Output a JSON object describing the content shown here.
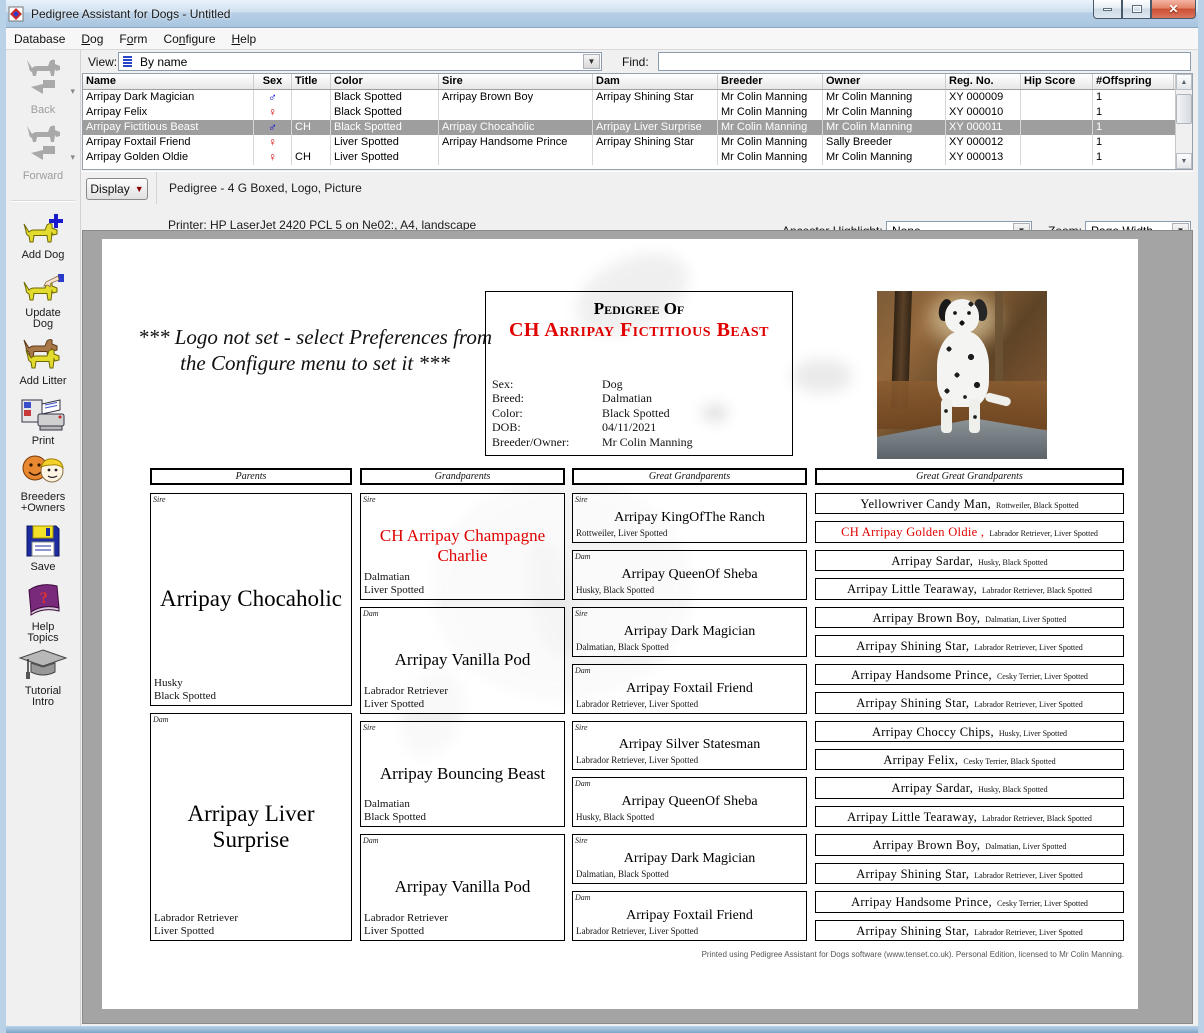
{
  "window": {
    "title": "Pedigree Assistant for Dogs - Untitled"
  },
  "menu": [
    {
      "pre": "Database",
      "u": "",
      "post": ""
    },
    {
      "pre": "",
      "u": "D",
      "post": "og"
    },
    {
      "pre": "F",
      "u": "o",
      "post": "rm"
    },
    {
      "pre": "Co",
      "u": "n",
      "post": "figure"
    },
    {
      "pre": "",
      "u": "H",
      "post": "elp"
    }
  ],
  "finder": {
    "view_label": "View:",
    "view_value": "By name",
    "find_label": "Find:",
    "find_value": ""
  },
  "grid": {
    "columns": [
      "Name",
      "Sex",
      "Title",
      "Color",
      "Sire",
      "Dam",
      "Breeder",
      "Owner",
      "Reg. No.",
      "Hip Score",
      "#Offspring"
    ],
    "rows": [
      {
        "name": "Arripay Dark Magician",
        "sex_glyph": "♂",
        "sex_class": "male",
        "title": "",
        "color": "Black Spotted",
        "sire": "Arripay Brown Boy",
        "dam": "Arripay Shining Star",
        "breeder": "Mr Colin Manning",
        "owner": "Mr Colin Manning",
        "reg_no": "XY 000009",
        "hip_score": "",
        "offspring": "1",
        "selected": false
      },
      {
        "name": "Arripay Felix",
        "sex_glyph": "♀",
        "sex_class": "female",
        "title": "",
        "color": "Black Spotted",
        "sire": "",
        "dam": "",
        "breeder": "Mr Colin Manning",
        "owner": "Mr Colin Manning",
        "reg_no": "XY 000010",
        "hip_score": "",
        "offspring": "1",
        "selected": false
      },
      {
        "name": "Arripay Fictitious Beast",
        "sex_glyph": "♂",
        "sex_class": "male",
        "title": "CH",
        "color": "Black Spotted",
        "sire": "Arripay Chocaholic",
        "dam": "Arripay Liver Surprise",
        "breeder": "Mr Colin Manning",
        "owner": "Mr Colin Manning",
        "reg_no": "XY 000011",
        "hip_score": "",
        "offspring": "1",
        "selected": true
      },
      {
        "name": "Arripay Foxtail Friend",
        "sex_glyph": "♀",
        "sex_class": "female",
        "title": "",
        "color": "Liver Spotted",
        "sire": "Arripay Handsome Prince",
        "dam": "Arripay Shining Star",
        "breeder": "Mr Colin Manning",
        "owner": "Sally Breeder",
        "reg_no": "XY 000012",
        "hip_score": "",
        "offspring": "1",
        "selected": false
      },
      {
        "name": "Arripay Golden Oldie",
        "sex_glyph": "♀",
        "sex_class": "female",
        "title": "CH",
        "color": "Liver Spotted",
        "sire": "",
        "dam": "",
        "breeder": "Mr Colin Manning",
        "owner": "Mr Colin Manning",
        "reg_no": "XY 000013",
        "hip_score": "",
        "offspring": "1",
        "selected": false
      }
    ]
  },
  "sidebar": [
    {
      "label": "Back",
      "disabled": true
    },
    {
      "label": "Forward",
      "disabled": true
    },
    {
      "label": "Add Dog",
      "disabled": false
    },
    {
      "label": "Update\nDog",
      "disabled": false
    },
    {
      "label": "Add Litter",
      "disabled": false
    },
    {
      "label": "Print",
      "disabled": false
    },
    {
      "label": "Breeders\n+Owners",
      "disabled": false
    },
    {
      "label": "Save",
      "disabled": false
    },
    {
      "label": "Help\nTopics",
      "disabled": false
    },
    {
      "label": "Tutorial\nIntro",
      "disabled": false
    }
  ],
  "display_bar": {
    "display_button": "Display",
    "view_title": "Pedigree - 4 G Boxed, Logo, Picture",
    "printer_line": "Printer: HP LaserJet 2420 PCL 5 on Ne02:, A4, landscape",
    "ancestor_highlight_label": "Ancestor Highlight:",
    "ancestor_highlight_value": "None",
    "zoom_label": "Zoom:",
    "zoom_value": "Page Width"
  },
  "pedigree": {
    "logo_notice": "*** Logo not set - select Preferences from the Configure menu to set it ***",
    "header": {
      "title": "Pedigree Of",
      "dog_name": "CH Arripay Fictitious Beast",
      "fields": [
        {
          "label": "Sex:",
          "value": "Dog"
        },
        {
          "label": "Breed:",
          "value": "Dalmatian"
        },
        {
          "label": "Color:",
          "value": "Black Spotted"
        },
        {
          "label": "DOB:",
          "value": "04/11/2021"
        },
        {
          "label": "Breeder/Owner:",
          "value": "Mr Colin Manning"
        }
      ]
    },
    "column_headers": [
      "Parents",
      "Grandparents",
      "Great Grandparents",
      "Great Great Grandparents"
    ],
    "parents": [
      {
        "role": "Sire",
        "name": "Arripay Chocaholic",
        "breed": "Husky",
        "color": "Black Spotted",
        "highlight": false
      },
      {
        "role": "Dam",
        "name": "Arripay Liver Surprise",
        "breed": "Labrador Retriever",
        "color": "Liver Spotted",
        "highlight": false
      }
    ],
    "grandparents": [
      {
        "role": "Sire",
        "name": "CH Arripay Champagne Charlie",
        "breed": "Dalmatian",
        "color": "Liver Spotted",
        "highlight": true
      },
      {
        "role": "Dam",
        "name": "Arripay Vanilla Pod",
        "breed": "Labrador Retriever",
        "color": "Liver Spotted",
        "highlight": false
      },
      {
        "role": "Sire",
        "name": "Arripay Bouncing Beast",
        "breed": "Dalmatian",
        "color": "Black Spotted",
        "highlight": false
      },
      {
        "role": "Dam",
        "name": "Arripay Vanilla Pod",
        "breed": "Labrador Retriever",
        "color": "Liver Spotted",
        "highlight": false
      }
    ],
    "great_grandparents": [
      {
        "role": "Sire",
        "name": "Arripay KingOfThe Ranch",
        "breed_color": "Rottweiler, Liver Spotted",
        "highlight": false
      },
      {
        "role": "Dam",
        "name": "Arripay QueenOf Sheba",
        "breed_color": "Husky, Black Spotted",
        "highlight": false
      },
      {
        "role": "Sire",
        "name": "Arripay Dark Magician",
        "breed_color": "Dalmatian, Black Spotted",
        "highlight": false
      },
      {
        "role": "Dam",
        "name": "Arripay Foxtail Friend",
        "breed_color": "Labrador Retriever, Liver Spotted",
        "highlight": false
      },
      {
        "role": "Sire",
        "name": "Arripay Silver Statesman",
        "breed_color": "Labrador Retriever, Liver Spotted",
        "highlight": false
      },
      {
        "role": "Dam",
        "name": "Arripay QueenOf Sheba",
        "breed_color": "Husky, Black Spotted",
        "highlight": false
      },
      {
        "role": "Sire",
        "name": "Arripay Dark Magician",
        "breed_color": "Dalmatian, Black Spotted",
        "highlight": false
      },
      {
        "role": "Dam",
        "name": "Arripay Foxtail Friend",
        "breed_color": "Labrador Retriever, Liver Spotted",
        "highlight": false
      }
    ],
    "great_great_grandparents": [
      {
        "name": "Yellowriver Candy Man,",
        "breed_color": "Rottweiler, Black Spotted",
        "highlight": false
      },
      {
        "name": "CH Arripay Golden Oldie ,",
        "breed_color": "Labrador Retriever, Liver Spotted",
        "highlight": true
      },
      {
        "name": "Arripay Sardar,",
        "breed_color": "Husky, Black Spotted",
        "highlight": false
      },
      {
        "name": "Arripay Little Tearaway,",
        "breed_color": "Labrador Retriever, Black Spotted",
        "highlight": false
      },
      {
        "name": "Arripay Brown Boy,",
        "breed_color": "Dalmatian, Liver Spotted",
        "highlight": false
      },
      {
        "name": "Arripay Shining Star,",
        "breed_color": "Labrador Retriever, Liver Spotted",
        "highlight": false
      },
      {
        "name": "Arripay Handsome Prince,",
        "breed_color": "Cesky Terrier, Liver Spotted",
        "highlight": false
      },
      {
        "name": "Arripay Shining Star,",
        "breed_color": "Labrador Retriever, Liver Spotted",
        "highlight": false
      },
      {
        "name": "Arripay Choccy Chips,",
        "breed_color": "Husky, Liver Spotted",
        "highlight": false
      },
      {
        "name": "Arripay Felix,",
        "breed_color": "Cesky Terrier, Black Spotted",
        "highlight": false
      },
      {
        "name": "Arripay Sardar,",
        "breed_color": "Husky, Black Spotted",
        "highlight": false
      },
      {
        "name": "Arripay Little Tearaway,",
        "breed_color": "Labrador Retriever, Black Spotted",
        "highlight": false
      },
      {
        "name": "Arripay Brown Boy,",
        "breed_color": "Dalmatian, Liver Spotted",
        "highlight": false
      },
      {
        "name": "Arripay Shining Star,",
        "breed_color": "Labrador Retriever, Liver Spotted",
        "highlight": false
      },
      {
        "name": "Arripay Handsome Prince,",
        "breed_color": "Cesky Terrier, Liver Spotted",
        "highlight": false
      },
      {
        "name": "Arripay Shining Star,",
        "breed_color": "Labrador Retriever, Liver Spotted",
        "highlight": false
      }
    ],
    "footer": "Printed using Pedigree Assistant for Dogs software (www.tenset.co.uk). Personal Edition, licensed to Mr Colin Manning."
  }
}
